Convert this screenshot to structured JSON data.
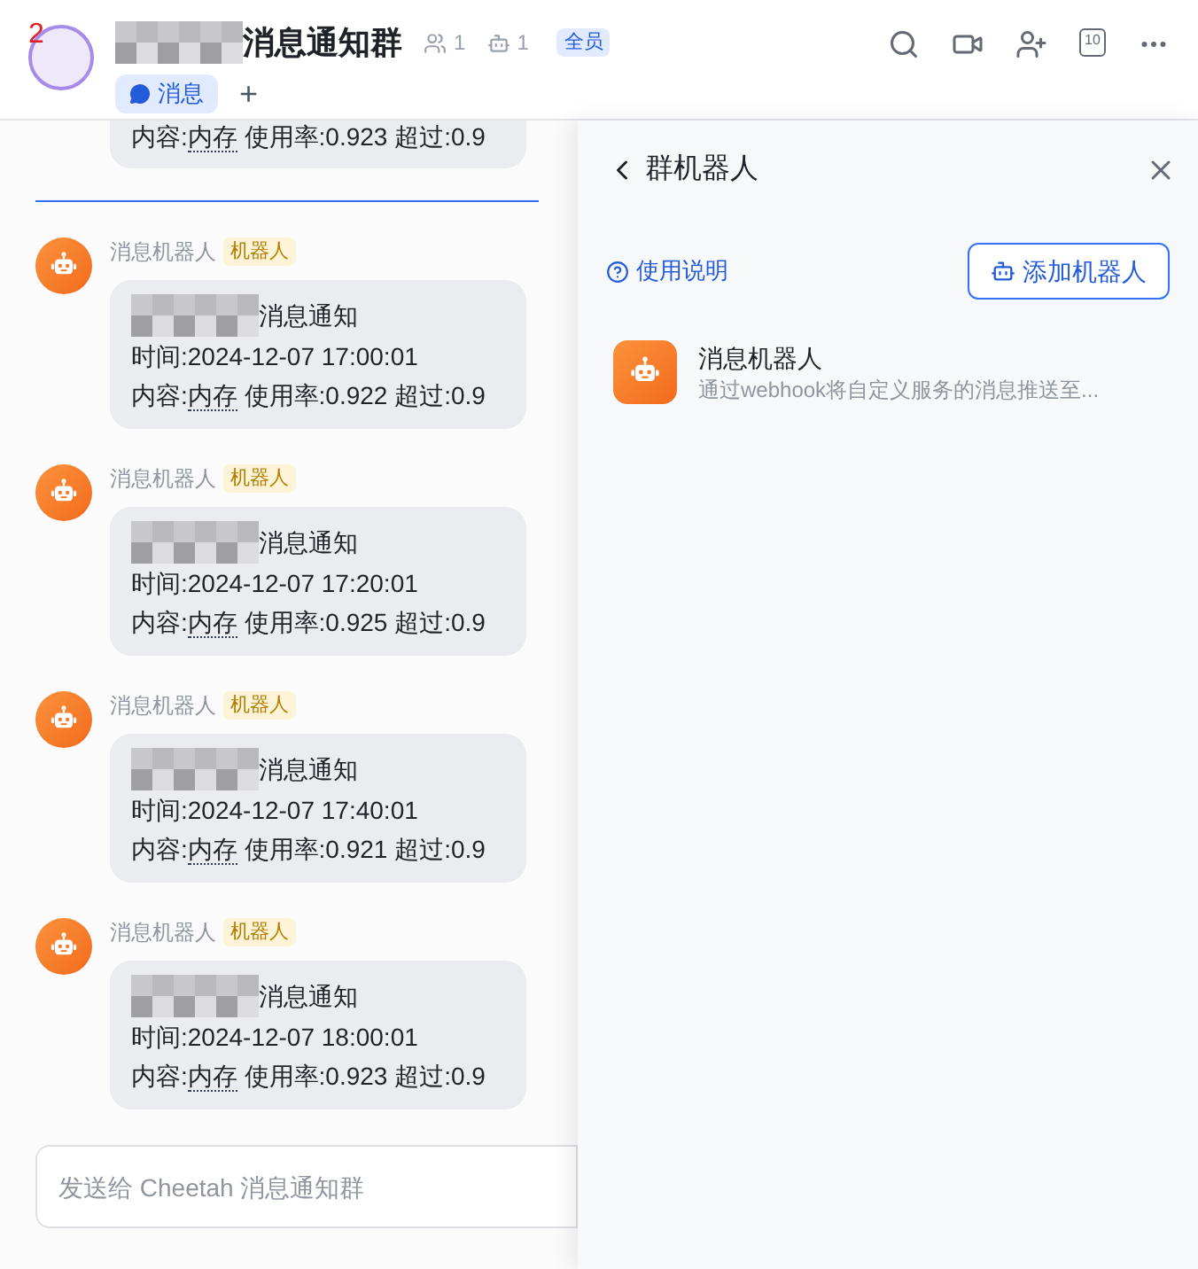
{
  "header": {
    "unread": "2",
    "title": "消息通知群",
    "member_count": "1",
    "bot_count": "1",
    "badge": "全员",
    "calendar_day": "10",
    "tabs": [
      {
        "label": "消息",
        "selected": true
      }
    ],
    "add_tab": "+"
  },
  "chat": {
    "partial_message": {
      "content_label": "内容:",
      "keyword": "内存",
      "content_rest": "使用率:0.923 超过:0.9"
    },
    "messages": [
      {
        "sender": "消息机器人",
        "tag": "机器人",
        "title": "消息通知",
        "time": "时间:2024-12-07 17:00:01",
        "content_label": "内容:",
        "keyword": "内存",
        "content_rest": "使用率:0.922 超过:0.9"
      },
      {
        "sender": "消息机器人",
        "tag": "机器人",
        "title": "消息通知",
        "time": "时间:2024-12-07 17:20:01",
        "content_label": "内容:",
        "keyword": "内存",
        "content_rest": "使用率:0.925 超过:0.9"
      },
      {
        "sender": "消息机器人",
        "tag": "机器人",
        "title": "消息通知",
        "time": "时间:2024-12-07 17:40:01",
        "content_label": "内容:",
        "keyword": "内存",
        "content_rest": "使用率:0.921 超过:0.9"
      },
      {
        "sender": "消息机器人",
        "tag": "机器人",
        "title": "消息通知",
        "time": "时间:2024-12-07 18:00:01",
        "content_label": "内容:",
        "keyword": "内存",
        "content_rest": "使用率:0.923 超过:0.9"
      }
    ],
    "input": {
      "placeholder": "发送给 Cheetah 消息通知群"
    }
  },
  "panel": {
    "title": "群机器人",
    "help_link": "使用说明",
    "add_button": "添加机器人",
    "bots": [
      {
        "name": "消息机器人",
        "description": "通过webhook将自定义服务的消息推送至..."
      }
    ]
  }
}
